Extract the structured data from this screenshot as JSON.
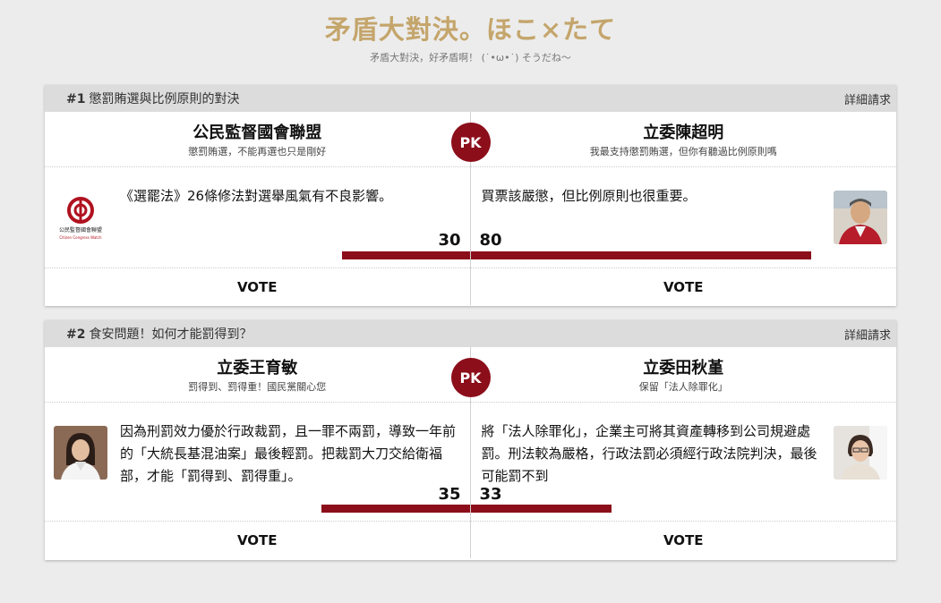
{
  "site": {
    "title": "矛盾大對決。ほこ×たて",
    "subtitle": "矛盾大對決，好矛盾啊！ (˙•ω•˙) そうだね〜"
  },
  "battles": [
    {
      "number": "#1",
      "title": "懲罰賄選與比例原則的對決",
      "detail_label": "詳細請求",
      "pk_label": "PK",
      "vote_label": "VOTE",
      "left": {
        "name": "公民監督國會聯盟",
        "tagline": "懲罰賄選，不能再選也只是剛好",
        "stance": "《選罷法》26條修法對選舉風氣有不良影響。",
        "score": "30",
        "avatar": "ccw-logo",
        "logo_text": "公民監督國會聯盟",
        "logo_text_en": "Citizen Congress Watch"
      },
      "right": {
        "name": "立委陳超明",
        "tagline": "我最支持懲罰賄選，但你有聽過比例原則嗎",
        "stance": "買票該嚴懲，但比例原則也很重要。",
        "score": "80",
        "avatar": "person-photo"
      }
    },
    {
      "number": "#2",
      "title": "食安問題！如何才能罰得到？",
      "detail_label": "詳細請求",
      "pk_label": "PK",
      "vote_label": "VOTE",
      "left": {
        "name": "立委王育敏",
        "tagline": "罰得到、罰得重！國民黨關心您",
        "stance": "因為刑罰效力優於行政裁罰，且一罪不兩罰，導致一年前的「大統長基混油案」最後輕罰。把裁罰大刀交給衛福部，才能「罰得到、罰得重」。",
        "score": "35",
        "avatar": "person-photo"
      },
      "right": {
        "name": "立委田秋堇",
        "tagline": "保留「法人除罪化」",
        "stance": "將「法人除罪化」，企業主可將其資產轉移到公司規避處罰。刑法較為嚴格，行政法罰必須經行政法院判決，最後可能罰不到",
        "score": "33",
        "avatar": "person-photo"
      }
    }
  ]
}
